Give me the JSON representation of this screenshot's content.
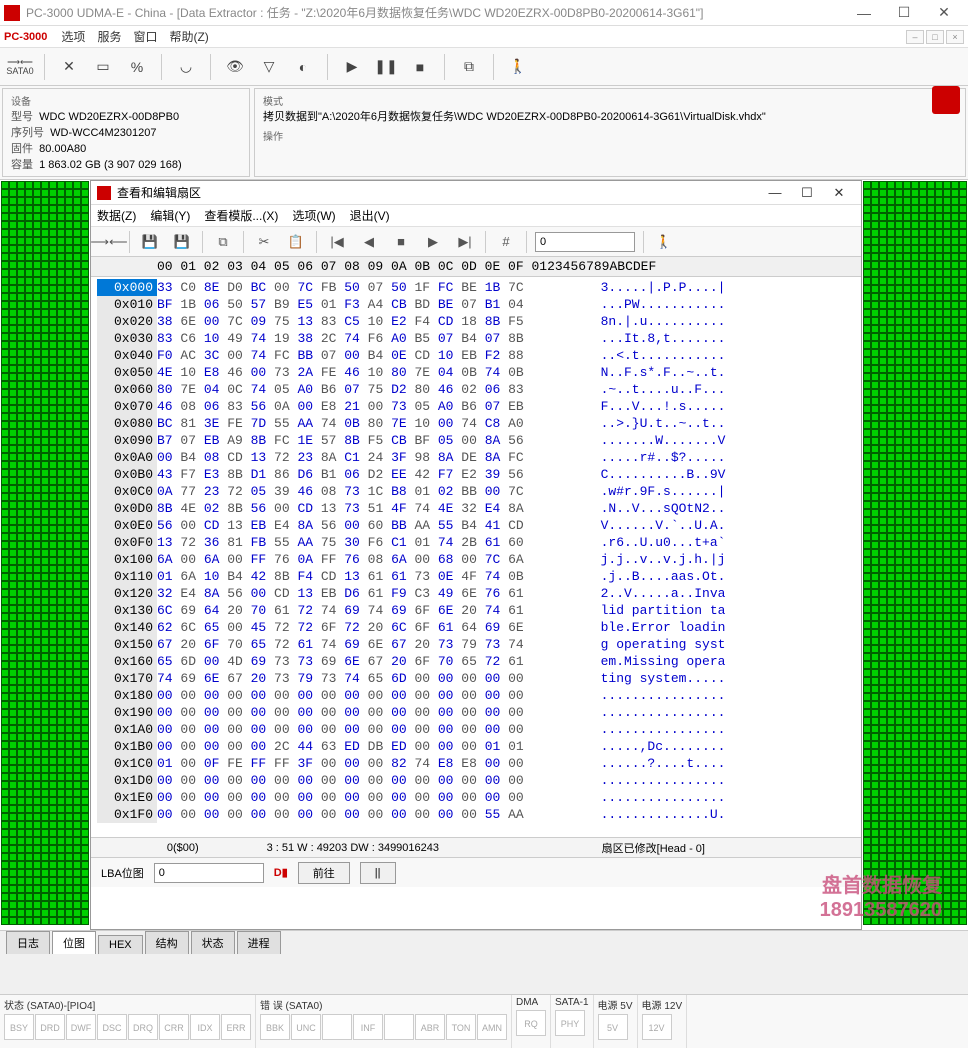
{
  "window": {
    "title": "PC-3000 UDMA-E - China - [Data Extractor : 任务 - \"Z:\\2020年6月数据恢复任务\\WDC WD20EZRX-00D8PB0-20200614-3G61\"]",
    "min": "—",
    "max": "☐",
    "close": "✕"
  },
  "menu": {
    "app": "PC-3000",
    "items": [
      "选项",
      "服务",
      "窗口",
      "帮助(Z)"
    ]
  },
  "toolbar": {
    "sata": "SATA0"
  },
  "device": {
    "header": "设备",
    "model_lbl": "型号",
    "model": "WDC WD20EZRX-00D8PB0",
    "serial_lbl": "序列号",
    "serial": "WD-WCC4M2301207",
    "fw_lbl": "固件",
    "fw": "80.00A80",
    "cap_lbl": "容量",
    "cap": "1 863.02 GB (3 907 029 168)"
  },
  "mode": {
    "header": "模式",
    "text": "拷贝数据到\"A:\\2020年6月数据恢复任务\\WDC WD20EZRX-00D8PB0-20200614-3G61\\VirtualDisk.vhdx\"",
    "op_header": "操作"
  },
  "hex": {
    "title": "查看和编辑扇区",
    "menu": [
      "数据(Z)",
      "编辑(Y)",
      "查看模版...(X)",
      "选项(W)",
      "退出(V)"
    ],
    "goto": "0",
    "header_off": "",
    "header_cols": "00 01 02 03 04 05 06 07 08 09 0A 0B 0C 0D 0E 0F  0123456789ABCDEF",
    "status": {
      "s1": "0($00)",
      "s2": "3 : 51 W : 49203 DW : 3499016243",
      "s3": "扇区已修改[Head - 0]"
    },
    "rows": [
      {
        "off": "0x000",
        "hex": "33 C0 8E D0 BC 00 7C FB 50 07 50 1F FC BE 1B 7C",
        "asc": "3.....|.P.P....|"
      },
      {
        "off": "0x010",
        "hex": "BF 1B 06 50 57 B9 E5 01 F3 A4 CB BD BE 07 B1 04",
        "asc": "...PW..........."
      },
      {
        "off": "0x020",
        "hex": "38 6E 00 7C 09 75 13 83 C5 10 E2 F4 CD 18 8B F5",
        "asc": "8n.|.u.........."
      },
      {
        "off": "0x030",
        "hex": "83 C6 10 49 74 19 38 2C 74 F6 A0 B5 07 B4 07 8B",
        "asc": "...It.8,t......."
      },
      {
        "off": "0x040",
        "hex": "F0 AC 3C 00 74 FC BB 07 00 B4 0E CD 10 EB F2 88",
        "asc": "..<.t..........."
      },
      {
        "off": "0x050",
        "hex": "4E 10 E8 46 00 73 2A FE 46 10 80 7E 04 0B 74 0B",
        "asc": "N..F.s*.F..~..t."
      },
      {
        "off": "0x060",
        "hex": "80 7E 04 0C 74 05 A0 B6 07 75 D2 80 46 02 06 83",
        "asc": ".~..t....u..F..."
      },
      {
        "off": "0x070",
        "hex": "46 08 06 83 56 0A 00 E8 21 00 73 05 A0 B6 07 EB",
        "asc": "F...V...!.s....."
      },
      {
        "off": "0x080",
        "hex": "BC 81 3E FE 7D 55 AA 74 0B 80 7E 10 00 74 C8 A0",
        "asc": "..>.}U.t..~..t.."
      },
      {
        "off": "0x090",
        "hex": "B7 07 EB A9 8B FC 1E 57 8B F5 CB BF 05 00 8A 56",
        "asc": ".......W.......V"
      },
      {
        "off": "0x0A0",
        "hex": "00 B4 08 CD 13 72 23 8A C1 24 3F 98 8A DE 8A FC",
        "asc": ".....r#..$?....."
      },
      {
        "off": "0x0B0",
        "hex": "43 F7 E3 8B D1 86 D6 B1 06 D2 EE 42 F7 E2 39 56",
        "asc": "C..........B..9V"
      },
      {
        "off": "0x0C0",
        "hex": "0A 77 23 72 05 39 46 08 73 1C B8 01 02 BB 00 7C",
        "asc": ".w#r.9F.s......|"
      },
      {
        "off": "0x0D0",
        "hex": "8B 4E 02 8B 56 00 CD 13 73 51 4F 74 4E 32 E4 8A",
        "asc": ".N..V...sQOtN2.."
      },
      {
        "off": "0x0E0",
        "hex": "56 00 CD 13 EB E4 8A 56 00 60 BB AA 55 B4 41 CD",
        "asc": "V......V.`..U.A."
      },
      {
        "off": "0x0F0",
        "hex": "13 72 36 81 FB 55 AA 75 30 F6 C1 01 74 2B 61 60",
        "asc": ".r6..U.u0...t+a`"
      },
      {
        "off": "0x100",
        "hex": "6A 00 6A 00 FF 76 0A FF 76 08 6A 00 68 00 7C 6A",
        "asc": "j.j..v..v.j.h.|j"
      },
      {
        "off": "0x110",
        "hex": "01 6A 10 B4 42 8B F4 CD 13 61 61 73 0E 4F 74 0B",
        "asc": ".j..B....aas.Ot."
      },
      {
        "off": "0x120",
        "hex": "32 E4 8A 56 00 CD 13 EB D6 61 F9 C3 49 6E 76 61",
        "asc": "2..V.....a..Inva"
      },
      {
        "off": "0x130",
        "hex": "6C 69 64 20 70 61 72 74 69 74 69 6F 6E 20 74 61",
        "asc": "lid partition ta"
      },
      {
        "off": "0x140",
        "hex": "62 6C 65 00 45 72 72 6F 72 20 6C 6F 61 64 69 6E",
        "asc": "ble.Error loadin"
      },
      {
        "off": "0x150",
        "hex": "67 20 6F 70 65 72 61 74 69 6E 67 20 73 79 73 74",
        "asc": "g operating syst"
      },
      {
        "off": "0x160",
        "hex": "65 6D 00 4D 69 73 73 69 6E 67 20 6F 70 65 72 61",
        "asc": "em.Missing opera"
      },
      {
        "off": "0x170",
        "hex": "74 69 6E 67 20 73 79 73 74 65 6D 00 00 00 00 00",
        "asc": "ting system....."
      },
      {
        "off": "0x180",
        "hex": "00 00 00 00 00 00 00 00 00 00 00 00 00 00 00 00",
        "asc": "................"
      },
      {
        "off": "0x190",
        "hex": "00 00 00 00 00 00 00 00 00 00 00 00 00 00 00 00",
        "asc": "................"
      },
      {
        "off": "0x1A0",
        "hex": "00 00 00 00 00 00 00 00 00 00 00 00 00 00 00 00",
        "asc": "................"
      },
      {
        "off": "0x1B0",
        "hex": "00 00 00 00 00 2C 44 63 ED DB ED 00 00 00 01 01",
        "asc": ".....,Dc........"
      },
      {
        "off": "0x1C0",
        "hex": "01 00 0F FE FF FF 3F 00 00 00 82 74 E8 E8 00 00",
        "asc": "......?....t...."
      },
      {
        "off": "0x1D0",
        "hex": "00 00 00 00 00 00 00 00 00 00 00 00 00 00 00 00",
        "asc": "................"
      },
      {
        "off": "0x1E0",
        "hex": "00 00 00 00 00 00 00 00 00 00 00 00 00 00 00 00",
        "asc": "................"
      },
      {
        "off": "0x1F0",
        "hex": "00 00 00 00 00 00 00 00 00 00 00 00 00 00 55 AA",
        "asc": "..............U."
      }
    ]
  },
  "lba": {
    "label": "LBA位图",
    "value": "0",
    "go": "前往",
    "pause": "||"
  },
  "tabs": [
    "日志",
    "位图",
    "HEX",
    "结构",
    "状态",
    "进程"
  ],
  "status_groups": [
    {
      "title": "状态 (SATA0)-[PIO4]",
      "cells": [
        "BSY",
        "DRD",
        "DWF",
        "DSC",
        "DRQ",
        "CRR",
        "IDX",
        "ERR"
      ]
    },
    {
      "title": "错 误 (SATA0)",
      "cells": [
        "BBK",
        "UNC",
        "",
        "INF",
        "",
        "ABR",
        "TON",
        "AMN"
      ]
    },
    {
      "title": "DMA",
      "cells": [
        "RQ"
      ]
    },
    {
      "title": "SATA-1",
      "cells": [
        "PHY"
      ]
    },
    {
      "title": "电源 5V",
      "cells": [
        "5V"
      ]
    },
    {
      "title": "电源 12V",
      "cells": [
        "12V"
      ]
    }
  ],
  "watermark": {
    "line1": "盘首数据恢复",
    "line2": "18913587620"
  }
}
